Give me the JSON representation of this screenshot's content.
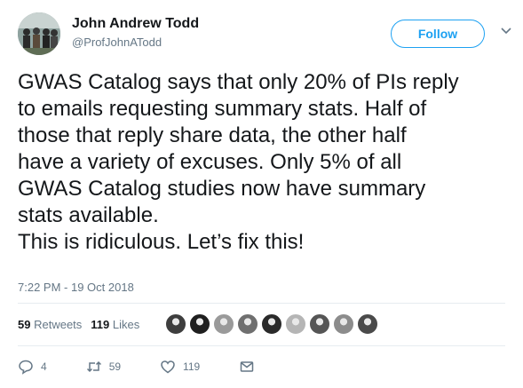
{
  "user": {
    "name": "John Andrew Todd",
    "handle": "@ProfJohnATodd"
  },
  "follow_label": "Follow",
  "tweet_lines": [
    "GWAS Catalog says that only 20% of PIs reply",
    "to emails requesting summary stats. Half of",
    "those that reply share data, the other half",
    "have a variety of excuses. Only 5% of all",
    "GWAS Catalog studies now have summary",
    "stats available.",
    "This is ridiculous. Let’s fix this!"
  ],
  "timestamp": "7:22 PM - 19 Oct 2018",
  "stats": {
    "retweets_count": "59",
    "retweets_label": "Retweets",
    "likes_count": "119",
    "likes_label": "Likes"
  },
  "liker_avatars": [
    "#3e3e3e",
    "#1f1f1f",
    "#9a9a9a",
    "#6f6f6f",
    "#2a2a2a",
    "#b5b5b5",
    "#555555",
    "#8c8c8c",
    "#4a4a4a"
  ],
  "actions": {
    "reply_count": "4",
    "retweet_count": "59",
    "like_count": "119",
    "icons": [
      "reply-icon",
      "retweet-icon",
      "like-icon",
      "message-icon"
    ]
  },
  "colors": {
    "accent": "#1da1f2",
    "secondary_text": "#657786",
    "divider": "#e6ecf0"
  }
}
